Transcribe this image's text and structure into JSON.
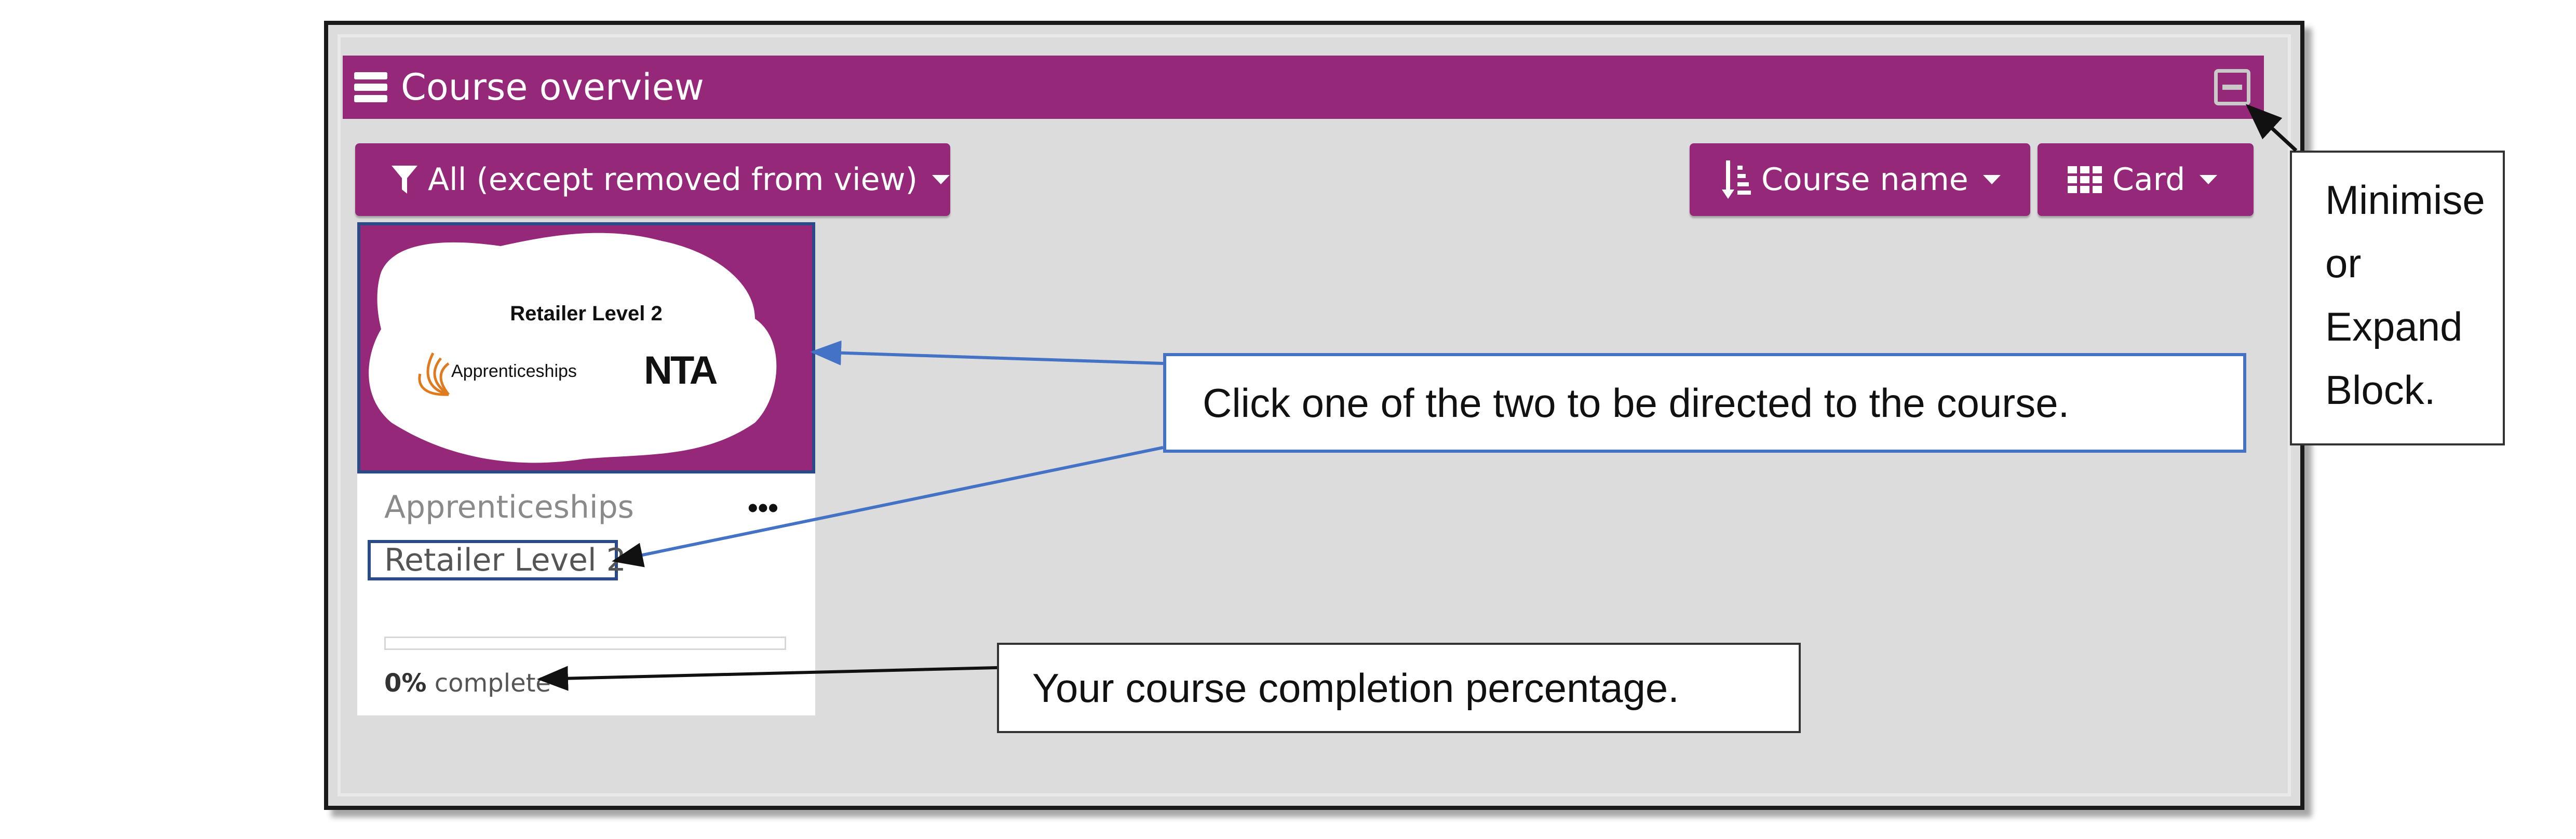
{
  "block": {
    "title": "Course overview",
    "collapse_icon": "minus-square-icon"
  },
  "controls": {
    "filter": {
      "icon": "funnel-icon",
      "label": "All (except removed from view)"
    },
    "sort": {
      "icon": "sort-alpha-icon",
      "label": "Course name"
    },
    "view": {
      "icon": "grid-icon",
      "label": "Card"
    }
  },
  "course_card": {
    "image_title": "Retailer Level 2",
    "image_brand": "Apprenticeships",
    "image_logo": "NTA",
    "category": "Apprenticeships",
    "name": "Retailer Level 2",
    "menu_icon": "more-horizontal-icon",
    "progress_percent": 0,
    "progress_value": "0%",
    "progress_suffix": " complete"
  },
  "annotations": {
    "course_link": "Click one of the two to be directed to the course.",
    "completion": "Your course completion percentage.",
    "block_toggle": [
      "Minimise",
      "or",
      "Expand",
      "Block."
    ]
  },
  "colors": {
    "brand": "#962879",
    "panel": "#dcdcdc",
    "annotation_border": "#4472c4"
  }
}
